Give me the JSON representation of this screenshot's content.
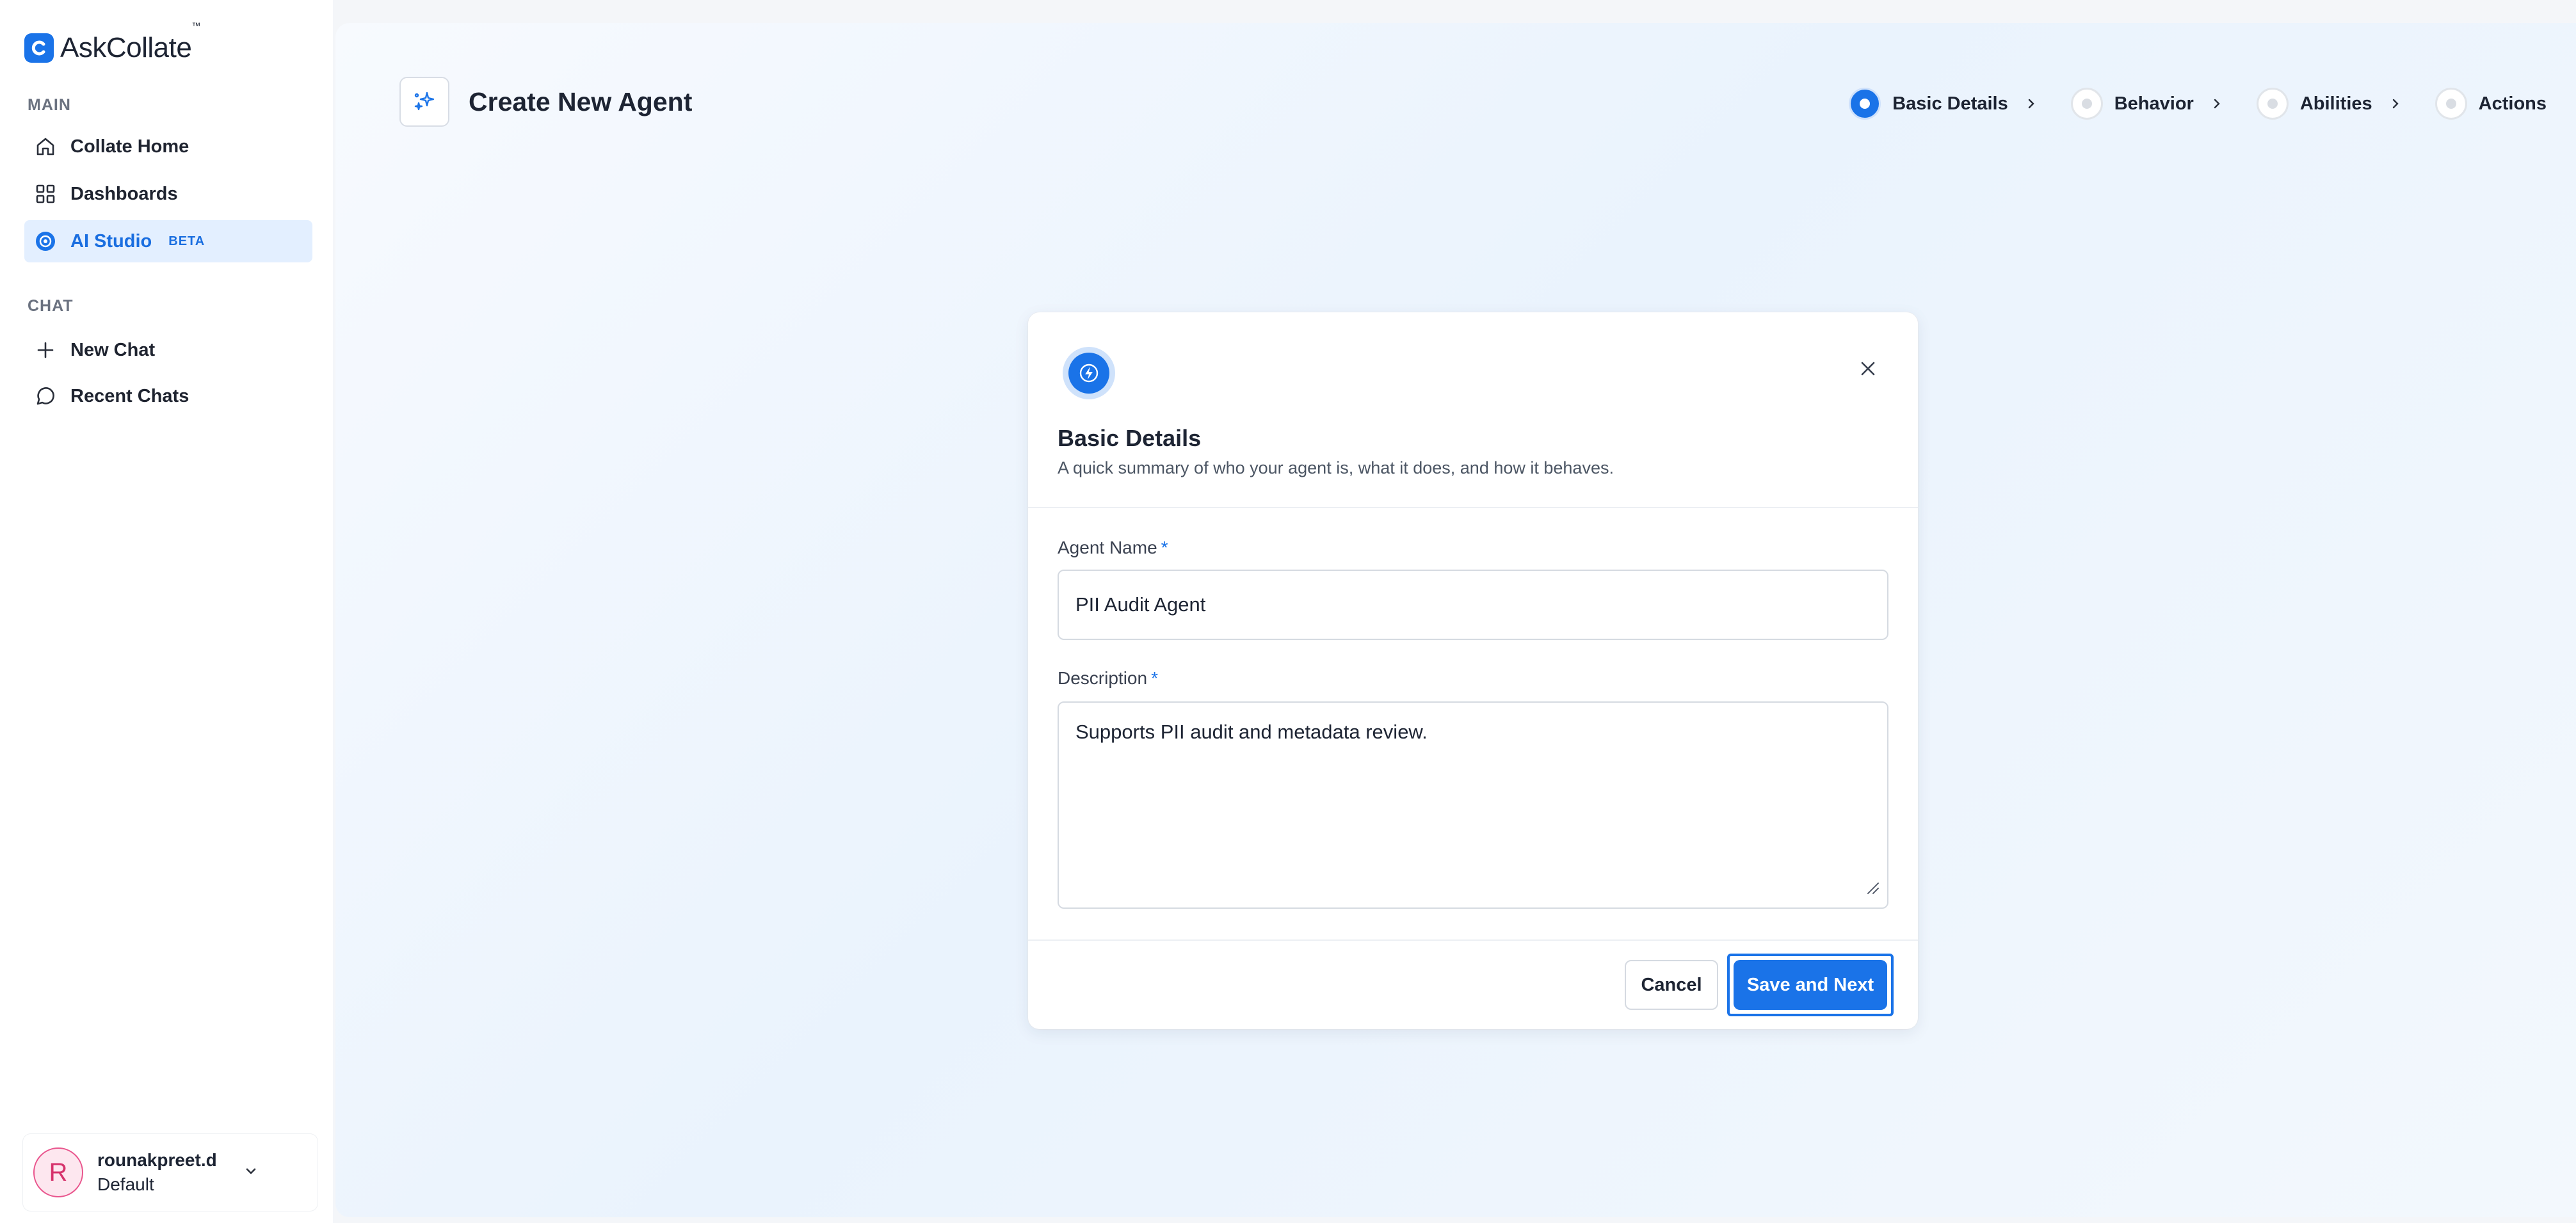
{
  "app": {
    "name": "AskCollate",
    "trademark": "™"
  },
  "sidebar": {
    "sections": [
      {
        "label": "MAIN"
      },
      {
        "label": "CHAT"
      }
    ],
    "main_items": [
      {
        "label": "Collate Home",
        "icon": "home-icon"
      },
      {
        "label": "Dashboards",
        "icon": "grid-icon"
      },
      {
        "label": "AI Studio",
        "icon": "ai-studio-icon",
        "badge": "BETA",
        "active": true
      }
    ],
    "chat_items": [
      {
        "label": "New Chat",
        "icon": "plus-icon"
      },
      {
        "label": "Recent Chats",
        "icon": "chat-bubble-icon"
      }
    ],
    "user": {
      "initial": "R",
      "name": "rounakpreet.d",
      "org": "Default"
    }
  },
  "header": {
    "title": "Create New Agent",
    "steps": [
      {
        "label": "Basic Details",
        "active": true
      },
      {
        "label": "Behavior",
        "active": false
      },
      {
        "label": "Abilities",
        "active": false
      },
      {
        "label": "Actions",
        "active": false
      }
    ]
  },
  "dialog": {
    "title": "Basic Details",
    "subtitle": "A quick summary of who your agent is, what it does, and how it behaves.",
    "agent_name": {
      "label": "Agent Name",
      "required_mark": "*",
      "value": "PII Audit Agent"
    },
    "description": {
      "label": "Description",
      "required_mark": "*",
      "value": "Supports PII audit and metadata review."
    },
    "cancel_label": "Cancel",
    "save_label": "Save and Next"
  },
  "colors": {
    "accent": "#1a73e8",
    "active_nav_bg": "#e3efff"
  }
}
